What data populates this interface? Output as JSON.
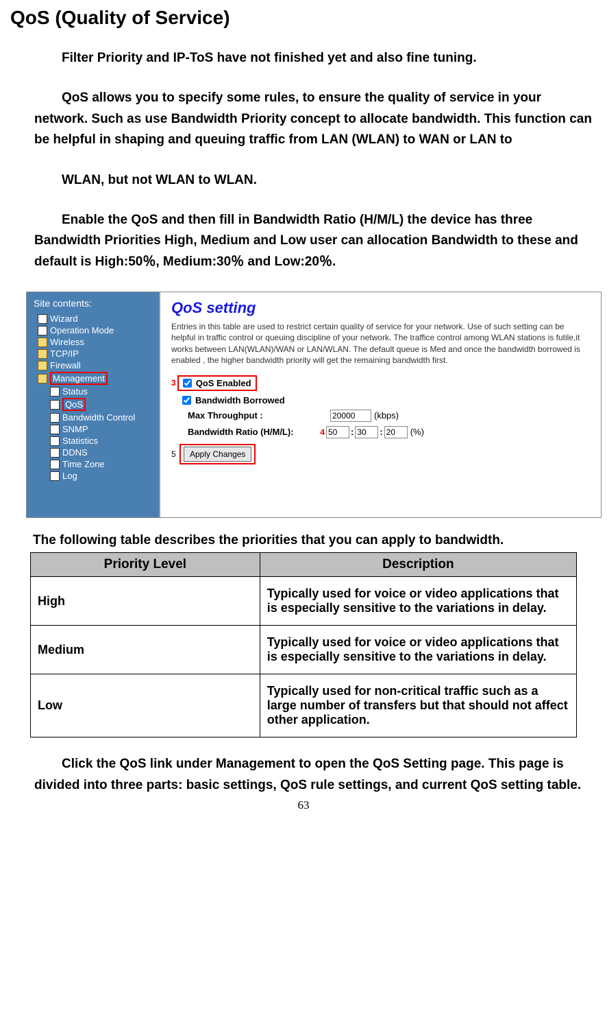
{
  "title": "QoS (Quality of Service)",
  "paragraphs": {
    "p1": "Filter Priority and IP-ToS have not finished yet and also fine tuning.",
    "p2": "QoS allows you to specify some rules, to ensure the quality of service in your network. Such as use Bandwidth Priority concept to allocate bandwidth. This function can be helpful in shaping and queuing traffic from LAN (WLAN) to WAN or LAN to",
    "p3": "WLAN, but not WLAN to WLAN.",
    "p4": "Enable the QoS and then fill in Bandwidth Ratio (H/M/L) the device has three Bandwidth Priorities High, Medium and Low user can allocation Bandwidth to these and default is High:50％, Medium:30％  and Low:20％."
  },
  "sidebar": {
    "title": "Site contents:",
    "items": [
      {
        "label": "Wizard",
        "type": "page",
        "nested": false,
        "boxed": false
      },
      {
        "label": "Operation Mode",
        "type": "page",
        "nested": false,
        "boxed": false
      },
      {
        "label": "Wireless",
        "type": "folder",
        "nested": false,
        "boxed": false
      },
      {
        "label": "TCP/IP",
        "type": "folder",
        "nested": false,
        "boxed": false
      },
      {
        "label": "Firewall",
        "type": "folder",
        "nested": false,
        "boxed": false
      },
      {
        "label": "Management",
        "type": "folder",
        "nested": false,
        "boxed": true
      },
      {
        "label": "Status",
        "type": "page",
        "nested": true,
        "boxed": false
      },
      {
        "label": "QoS",
        "type": "page",
        "nested": true,
        "boxed": true
      },
      {
        "label": "Bandwidth Control",
        "type": "page",
        "nested": true,
        "boxed": false
      },
      {
        "label": "SNMP",
        "type": "page",
        "nested": true,
        "boxed": false
      },
      {
        "label": "Statistics",
        "type": "page",
        "nested": true,
        "boxed": false
      },
      {
        "label": "DDNS",
        "type": "page",
        "nested": true,
        "boxed": false
      },
      {
        "label": "Time Zone",
        "type": "page",
        "nested": true,
        "boxed": false
      },
      {
        "label": "Log",
        "type": "page",
        "nested": true,
        "boxed": false
      }
    ]
  },
  "panel": {
    "title": "QoS setting",
    "desc": "Entries in this table are used to restrict certain quality of service for your network. Use of such setting can be helpful in traffic control or queuing discipline of your network. The traffice control among WLAN stations is futile,it works between LAN(WLAN)/WAN or LAN/WLAN. The default queue is Med and once the bandwidth borrowed is enabled , the higher bandwidth priority will get the remaining bandwidth first.",
    "qos_enabled_label": "QoS Enabled",
    "bw_borrowed_label": "Bandwidth Borrowed",
    "max_throughput_label": "Max Throughput :",
    "max_throughput_value": "20000",
    "max_throughput_unit": "(kbps)",
    "ratio_label": "Bandwidth Ratio (H/M/L):",
    "ratio_h": "50",
    "ratio_m": "30",
    "ratio_l": "20",
    "ratio_unit": "(%)",
    "apply_label": "Apply Changes",
    "marker3": "3",
    "marker4": "4",
    "marker5": "5"
  },
  "table_lead": "The following table describes the priorities that you can apply to bandwidth.",
  "table": {
    "head": {
      "level": "Priority Level",
      "desc": "Description"
    },
    "rows": [
      {
        "level": "High",
        "desc": "Typically used for voice or video applications that is especially sensitive to the variations in delay."
      },
      {
        "level": "Medium",
        "desc": "Typically used for voice or video applications that is especially sensitive to the variations in delay."
      },
      {
        "level": "Low",
        "desc": "Typically used for non-critical traffic such as a large number of transfers but that should not affect other application."
      }
    ]
  },
  "closing": "Click the QoS link under Management to open the QoS Setting page. This page is divided into three parts: basic settings, QoS rule settings, and current QoS setting table.",
  "pagenum": "63"
}
